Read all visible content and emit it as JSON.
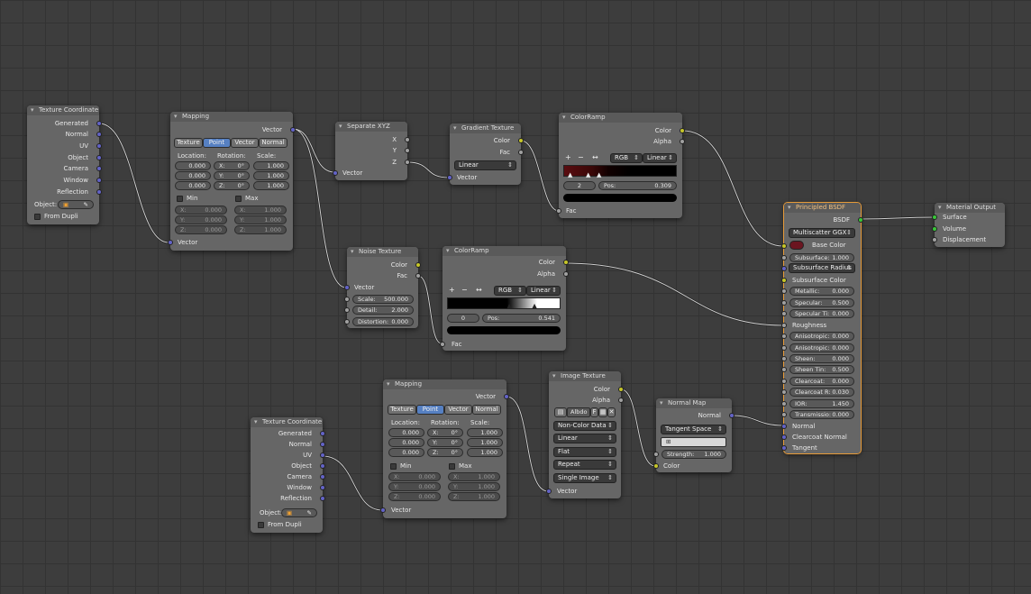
{
  "colors": {
    "vector_socket": "#6363c7",
    "color_socket": "#c7c729",
    "float_socket": "#a1a1a1",
    "shader_socket": "#39c739",
    "selected_outline": "#e69a38",
    "base_color": "#6b1520"
  },
  "nodes": {
    "tc1": {
      "title": "Texture Coordinate",
      "outputs": [
        "Generated",
        "Normal",
        "UV",
        "Object",
        "Camera",
        "Window",
        "Reflection"
      ],
      "object_label": "Object:",
      "from_dupli": "From Dupli"
    },
    "map1": {
      "title": "Mapping",
      "vector_out": "Vector",
      "tabs": [
        "Texture",
        "Point",
        "Vector",
        "Normal"
      ],
      "active_tab": "Point",
      "loc_label": "Location:",
      "rot_label": "Rotation:",
      "scale_label": "Scale:",
      "location": [
        "0.000",
        "0.000",
        "0.000"
      ],
      "rotation": [
        "0°",
        "0°",
        "0°"
      ],
      "scale": [
        "1.000",
        "1.000",
        "1.000"
      ],
      "min_label": "Min",
      "max_label": "Max",
      "min": [
        "0.000",
        "0.000",
        "0.000"
      ],
      "max": [
        "1.000",
        "1.000",
        "1.000"
      ],
      "vector_in": "Vector"
    },
    "sep": {
      "title": "Separate XYZ",
      "outputs": [
        "X",
        "Y",
        "Z"
      ],
      "vector_in": "Vector"
    },
    "grad": {
      "title": "Gradient Texture",
      "outputs": [
        "Color",
        "Fac"
      ],
      "type": "Linear",
      "vector_in": "Vector"
    },
    "ramp1": {
      "title": "ColorRamp",
      "outputs": [
        "Color",
        "Alpha"
      ],
      "mode": "RGB",
      "interp": "Linear",
      "index": "2",
      "pos_label": "Pos:",
      "pos": "0.309",
      "fac_in": "Fac"
    },
    "noise": {
      "title": "Noise Texture",
      "outputs": [
        "Color",
        "Fac"
      ],
      "vector_in": "Vector",
      "fields": [
        {
          "label": "Scale:",
          "value": "500.000"
        },
        {
          "label": "Detail:",
          "value": "2.000"
        },
        {
          "label": "Distortion:",
          "value": "0.000"
        }
      ]
    },
    "ramp2": {
      "title": "ColorRamp",
      "outputs": [
        "Color",
        "Alpha"
      ],
      "mode": "RGB",
      "interp": "Linear",
      "index": "0",
      "pos_label": "Pos:",
      "pos": "0.541",
      "fac_in": "Fac"
    },
    "map2": {
      "title": "Mapping",
      "vector_out": "Vector",
      "tabs": [
        "Texture",
        "Point",
        "Vector",
        "Normal"
      ],
      "active_tab": "Point",
      "loc_label": "Location:",
      "rot_label": "Rotation:",
      "scale_label": "Scale:",
      "location": [
        "0.000",
        "0.000",
        "0.000"
      ],
      "rotation": [
        "0°",
        "0°",
        "0°"
      ],
      "scale": [
        "1.000",
        "1.000",
        "1.000"
      ],
      "min_label": "Min",
      "max_label": "Max",
      "min": [
        "0.000",
        "0.000",
        "0.000"
      ],
      "max": [
        "1.000",
        "1.000",
        "1.000"
      ],
      "vector_in": "Vector"
    },
    "tc2": {
      "title": "Texture Coordinate",
      "outputs": [
        "Generated",
        "Normal",
        "UV",
        "Object",
        "Camera",
        "Window",
        "Reflection"
      ],
      "object_label": "Object:",
      "from_dupli": "From Dupli"
    },
    "img": {
      "title": "Image Texture",
      "outputs": [
        "Color",
        "Alpha"
      ],
      "image_name": "Albdo",
      "fake_user": "F",
      "color_space": "Non-Color Data",
      "interpolation": "Linear",
      "projection": "Flat",
      "extension": "Repeat",
      "source": "Single Image",
      "vector_in": "Vector"
    },
    "nmap": {
      "title": "Normal Map",
      "output": "Normal",
      "space": "Tangent Space",
      "strength_label": "Strength:",
      "strength": "1.000",
      "color_in": "Color"
    },
    "bsdf": {
      "title": "Principled BSDF",
      "output": "BSDF",
      "distribution": "Multiscatter GGX",
      "base_color_label": "Base Color",
      "subsurface_label": "Subsurface:",
      "subsurface": "1.000",
      "subsurface_radius": "Subsurface Radius",
      "subsurface_color": "Subsurface Color",
      "params": [
        {
          "label": "Metallic:",
          "value": "0.000"
        },
        {
          "label": "Specular:",
          "value": "0.500"
        },
        {
          "label": "Specular Ti:",
          "value": "0.000"
        }
      ],
      "roughness": "Roughness",
      "params2": [
        {
          "label": "Anisotropic:",
          "value": "0.000"
        },
        {
          "label": "Anisotropic:",
          "value": "0.000"
        },
        {
          "label": "Sheen:",
          "value": "0.000"
        },
        {
          "label": "Sheen Tin:",
          "value": "0.500"
        },
        {
          "label": "Clearcoat:",
          "value": "0.000"
        },
        {
          "label": "Clearcoat R:",
          "value": "0.030"
        },
        {
          "label": "IOR:",
          "value": "1.450"
        },
        {
          "label": "Transmissio:",
          "value": "0.000"
        }
      ],
      "inputs": [
        "Normal",
        "Clearcoat Normal",
        "Tangent"
      ]
    },
    "out": {
      "title": "Material Output",
      "inputs": [
        "Surface",
        "Volume",
        "Displacement"
      ]
    }
  }
}
